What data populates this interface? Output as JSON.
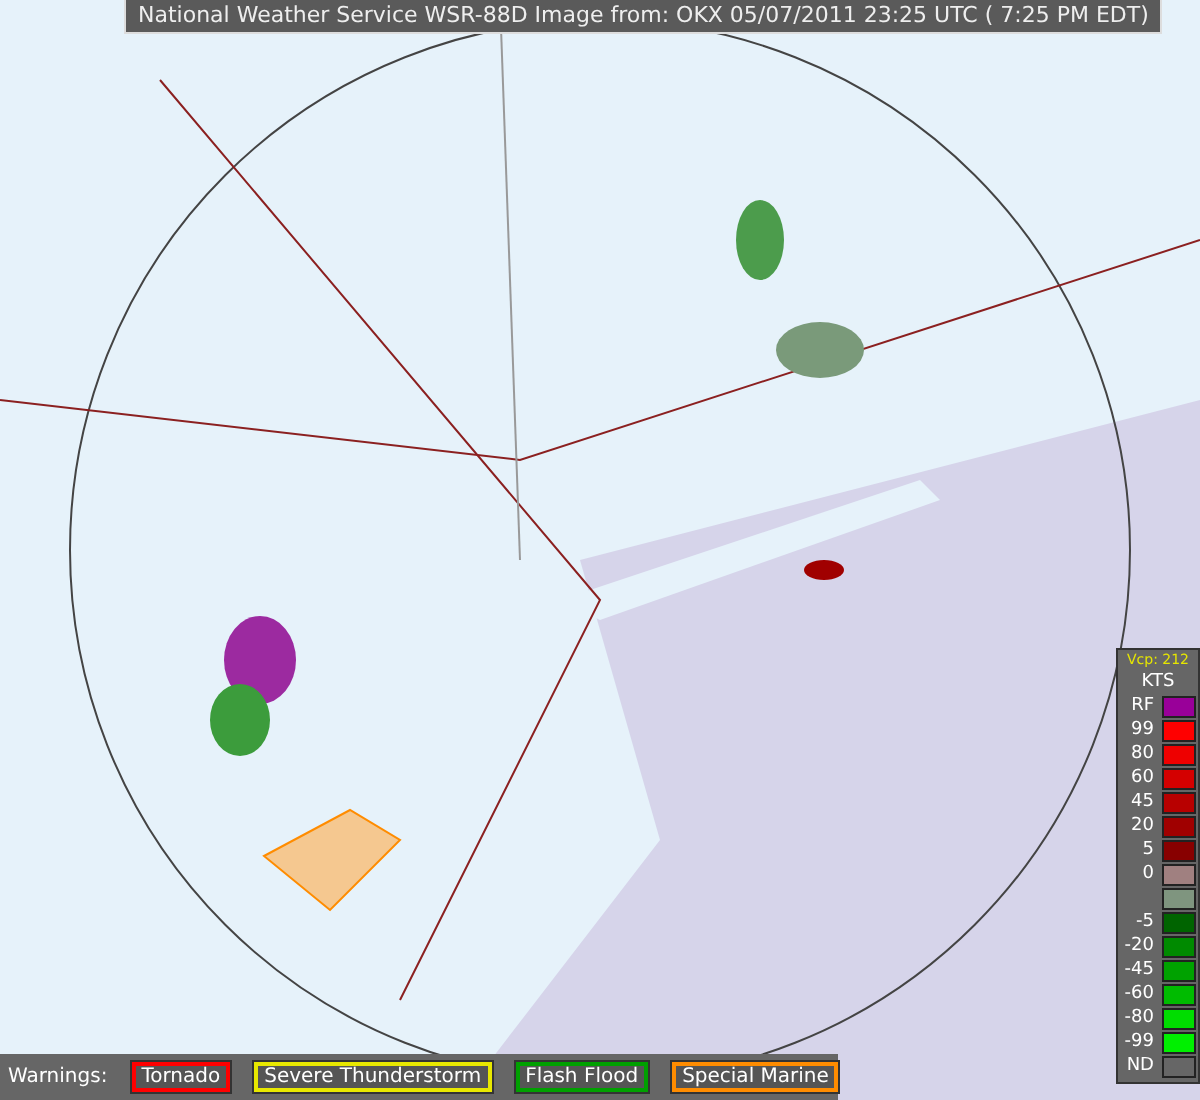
{
  "title": "National Weather Service WSR-88D Image from:  OKX  05/07/2011  23:25 UTC ( 7:25 PM EDT)",
  "legend": {
    "vcp": "Vcp: 212",
    "units": "KTS",
    "entries": [
      {
        "label": "RF",
        "color": "#990099"
      },
      {
        "label": "99",
        "color": "#ff0000"
      },
      {
        "label": "80",
        "color": "#ee0000"
      },
      {
        "label": "60",
        "color": "#d40000"
      },
      {
        "label": "45",
        "color": "#b80000"
      },
      {
        "label": "20",
        "color": "#a00000"
      },
      {
        "label": "5",
        "color": "#880000"
      },
      {
        "label": "0",
        "color": "#a08080"
      },
      {
        "color": "#7f957f"
      },
      {
        "label": "-5",
        "color": "#006400"
      },
      {
        "label": "-20",
        "color": "#008a00"
      },
      {
        "label": "-45",
        "color": "#00a200"
      },
      {
        "label": "-60",
        "color": "#00bb00"
      },
      {
        "label": "-80",
        "color": "#00dd00"
      },
      {
        "label": "-99",
        "color": "#00f000"
      },
      {
        "label": "ND",
        "color": "#666666"
      }
    ]
  },
  "warnings": {
    "label": "Warnings:",
    "items": [
      {
        "label": "Tornado",
        "color": "#ff0000"
      },
      {
        "label": "Severe Thunderstorm",
        "color": "#e8e800"
      },
      {
        "label": "Flash Flood",
        "color": "#00a000"
      },
      {
        "label": "Special Marine",
        "color": "#ff8c00"
      }
    ]
  }
}
